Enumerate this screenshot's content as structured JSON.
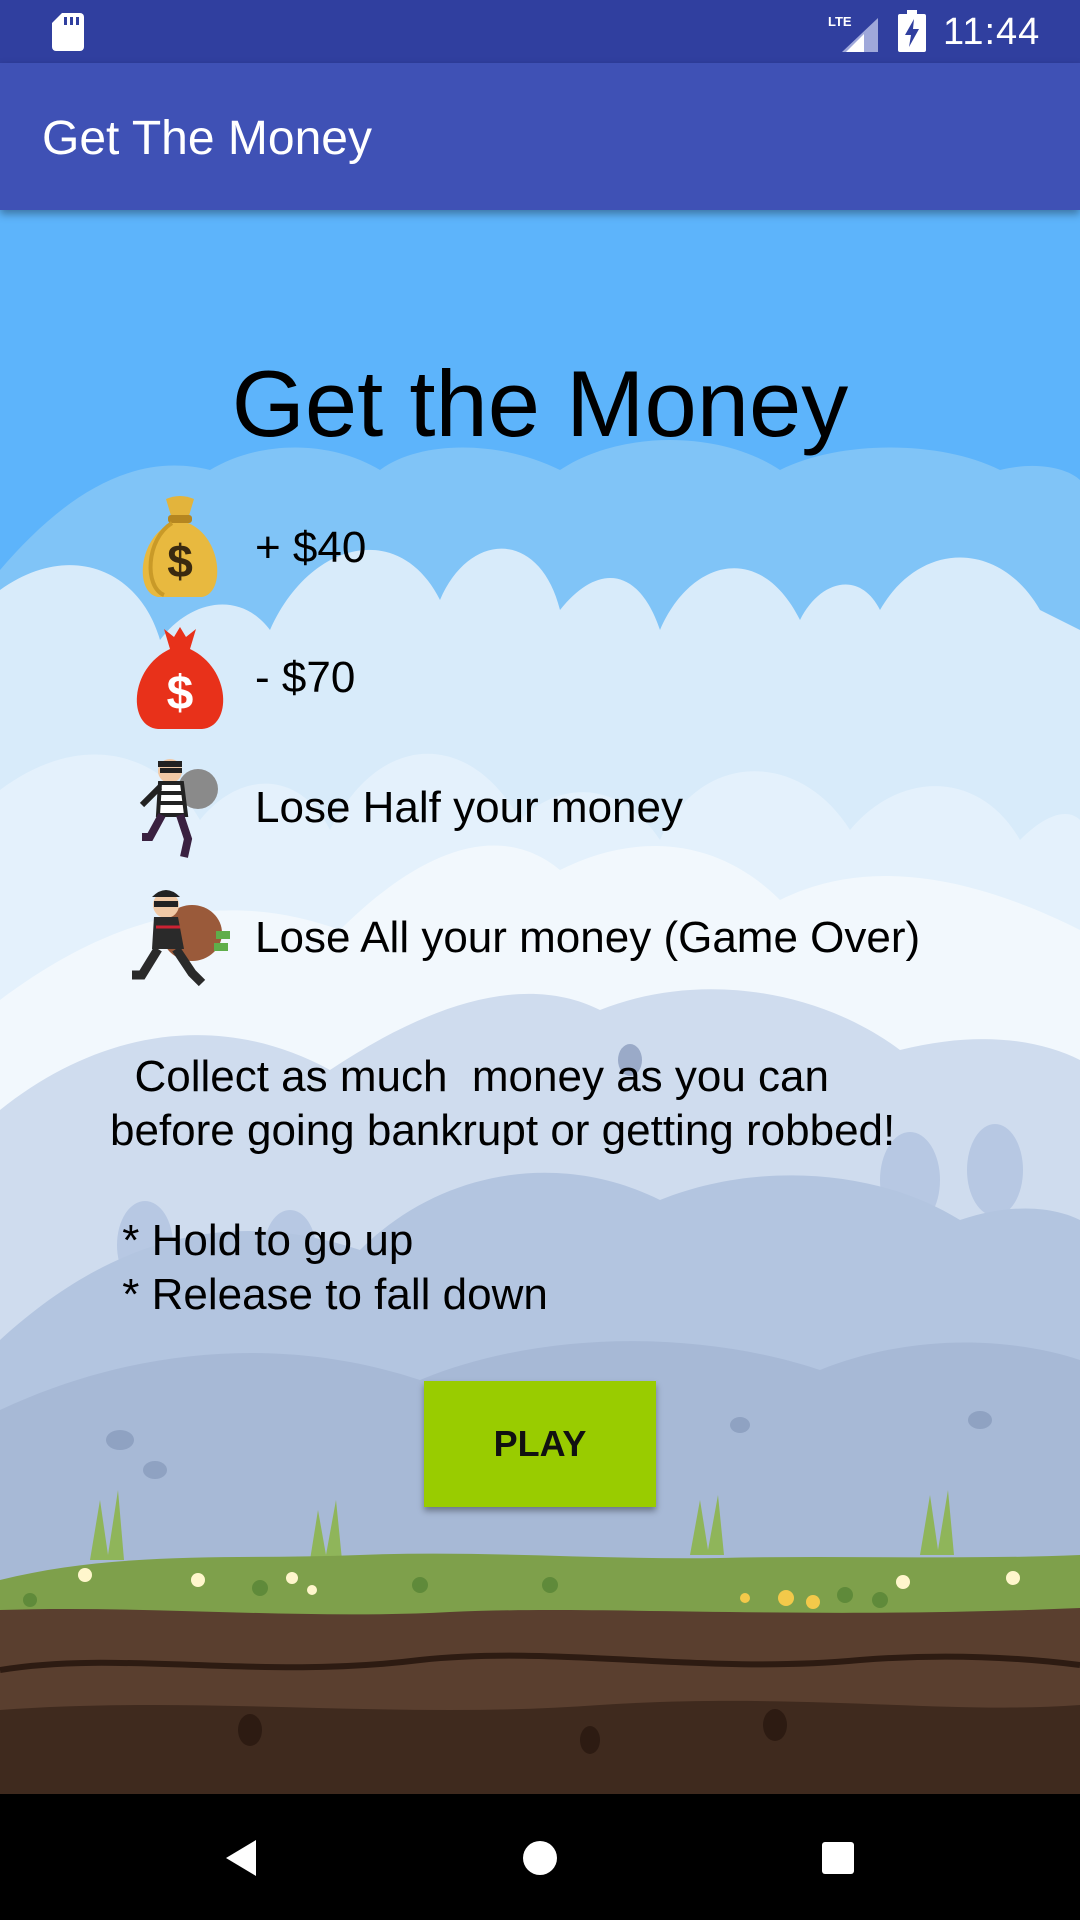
{
  "status_bar": {
    "time": "11:44",
    "icons": [
      "sd-card-icon",
      "lte-signal-icon",
      "battery-charging-icon"
    ]
  },
  "app_bar": {
    "title": "Get The Money"
  },
  "game": {
    "title": "Get the Money",
    "legend": [
      {
        "icon": "gold-money-bag-icon",
        "text": "+ $40"
      },
      {
        "icon": "red-money-bag-icon",
        "text": "- $70"
      },
      {
        "icon": "small-robber-icon",
        "text": "Lose Half your money"
      },
      {
        "icon": "big-robber-icon",
        "text": "Lose All your money (Game Over)"
      }
    ],
    "instructions": {
      "line1": "  Collect as much  money as you can",
      "line2": "before going bankrupt or getting robbed!",
      "line3": " * Hold to go up",
      "line4": " * Release to fall down"
    },
    "play_label": "PLAY"
  },
  "nav_bar": {
    "buttons": [
      "back-icon",
      "home-icon",
      "recents-icon"
    ]
  },
  "colors": {
    "status_bar": "#303f9f",
    "app_bar": "#3f51b5",
    "sky": "#5db4fb",
    "play_button": "#99cc00"
  }
}
